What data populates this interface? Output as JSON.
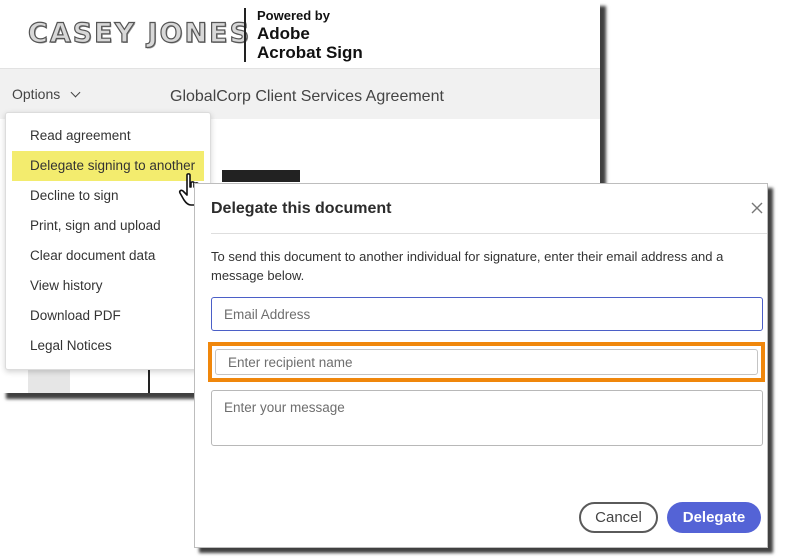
{
  "brand": {
    "logo_text": "CASEY JONES",
    "powered_by": "Powered by",
    "adobe": "Adobe",
    "acrobat_sign": "Acrobat Sign"
  },
  "toolbar": {
    "options_label": "Options",
    "document_title": "GlobalCorp Client Services Agreement"
  },
  "menu": {
    "items": [
      {
        "label": "Read agreement"
      },
      {
        "label": "Delegate signing to another",
        "highlighted": true
      },
      {
        "label": "Decline to sign"
      },
      {
        "label": "Print, sign and upload"
      },
      {
        "label": "Clear document data"
      },
      {
        "label": "View history"
      },
      {
        "label": "Download PDF"
      },
      {
        "label": "Legal Notices"
      }
    ]
  },
  "dialog": {
    "title": "Delegate this document",
    "instructions": "To send this document to another individual for signature, enter their email address and a message below.",
    "email_placeholder": "Email Address",
    "email_value": "",
    "name_placeholder": "Enter recipient name",
    "name_value": "",
    "message_placeholder": "Enter your message",
    "message_value": "",
    "cancel_label": "Cancel",
    "delegate_label": "Delegate"
  },
  "colors": {
    "menu_highlight": "#f3ec6e",
    "callout_border": "#f0870c",
    "primary_button": "#5463d6",
    "email_focus_border": "#4b5fc7"
  },
  "icons": {
    "options_chevron": "chevron-down-icon",
    "cursor": "hand-pointer-icon",
    "close": "close-icon"
  }
}
